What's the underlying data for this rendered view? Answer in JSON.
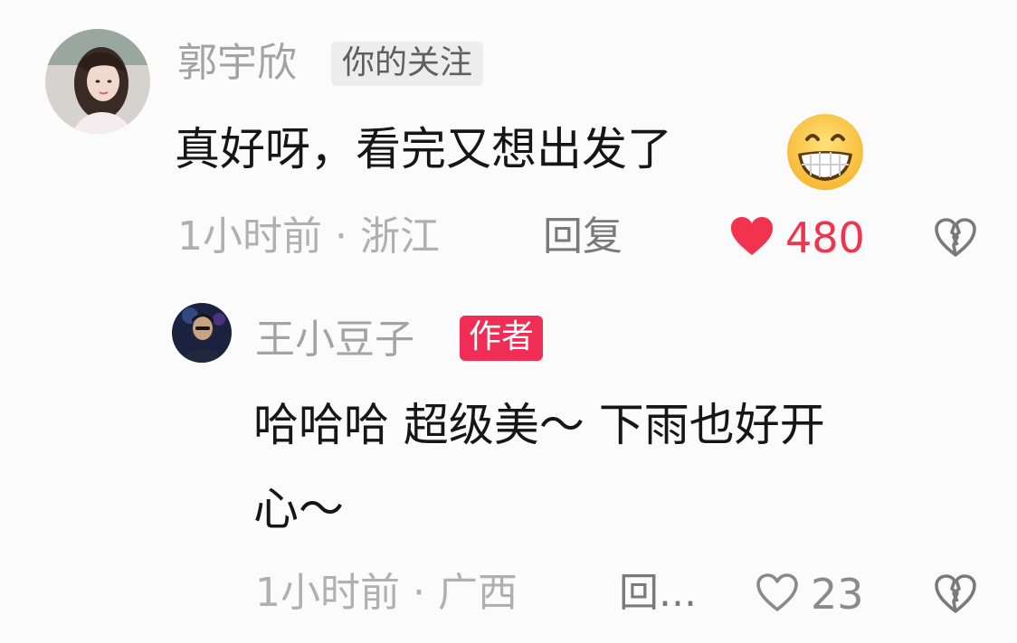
{
  "comment": {
    "user": {
      "name": "郭宇欣",
      "badge": "你的关注",
      "avatar_icon": "avatar-woman"
    },
    "text": "真好呀，看完又想出发了",
    "emoji": "grinning-face-emoji",
    "meta": "1小时前 · 浙江",
    "reply_label": "回复",
    "likes": "480",
    "liked": true,
    "like_color": "#f2334f",
    "dislike_icon": "broken-heart-icon"
  },
  "reply": {
    "user": {
      "name": "王小豆子",
      "badge": "作者",
      "badge_color": "#f02d55",
      "avatar_icon": "avatar-man"
    },
    "text_line1": "哈哈哈 超级美～ 下雨也好开",
    "text_line2": "心～",
    "meta": "1小时前 · 广西",
    "reply_label": "回...",
    "likes": "23",
    "liked": false,
    "dislike_icon": "broken-heart-icon"
  }
}
